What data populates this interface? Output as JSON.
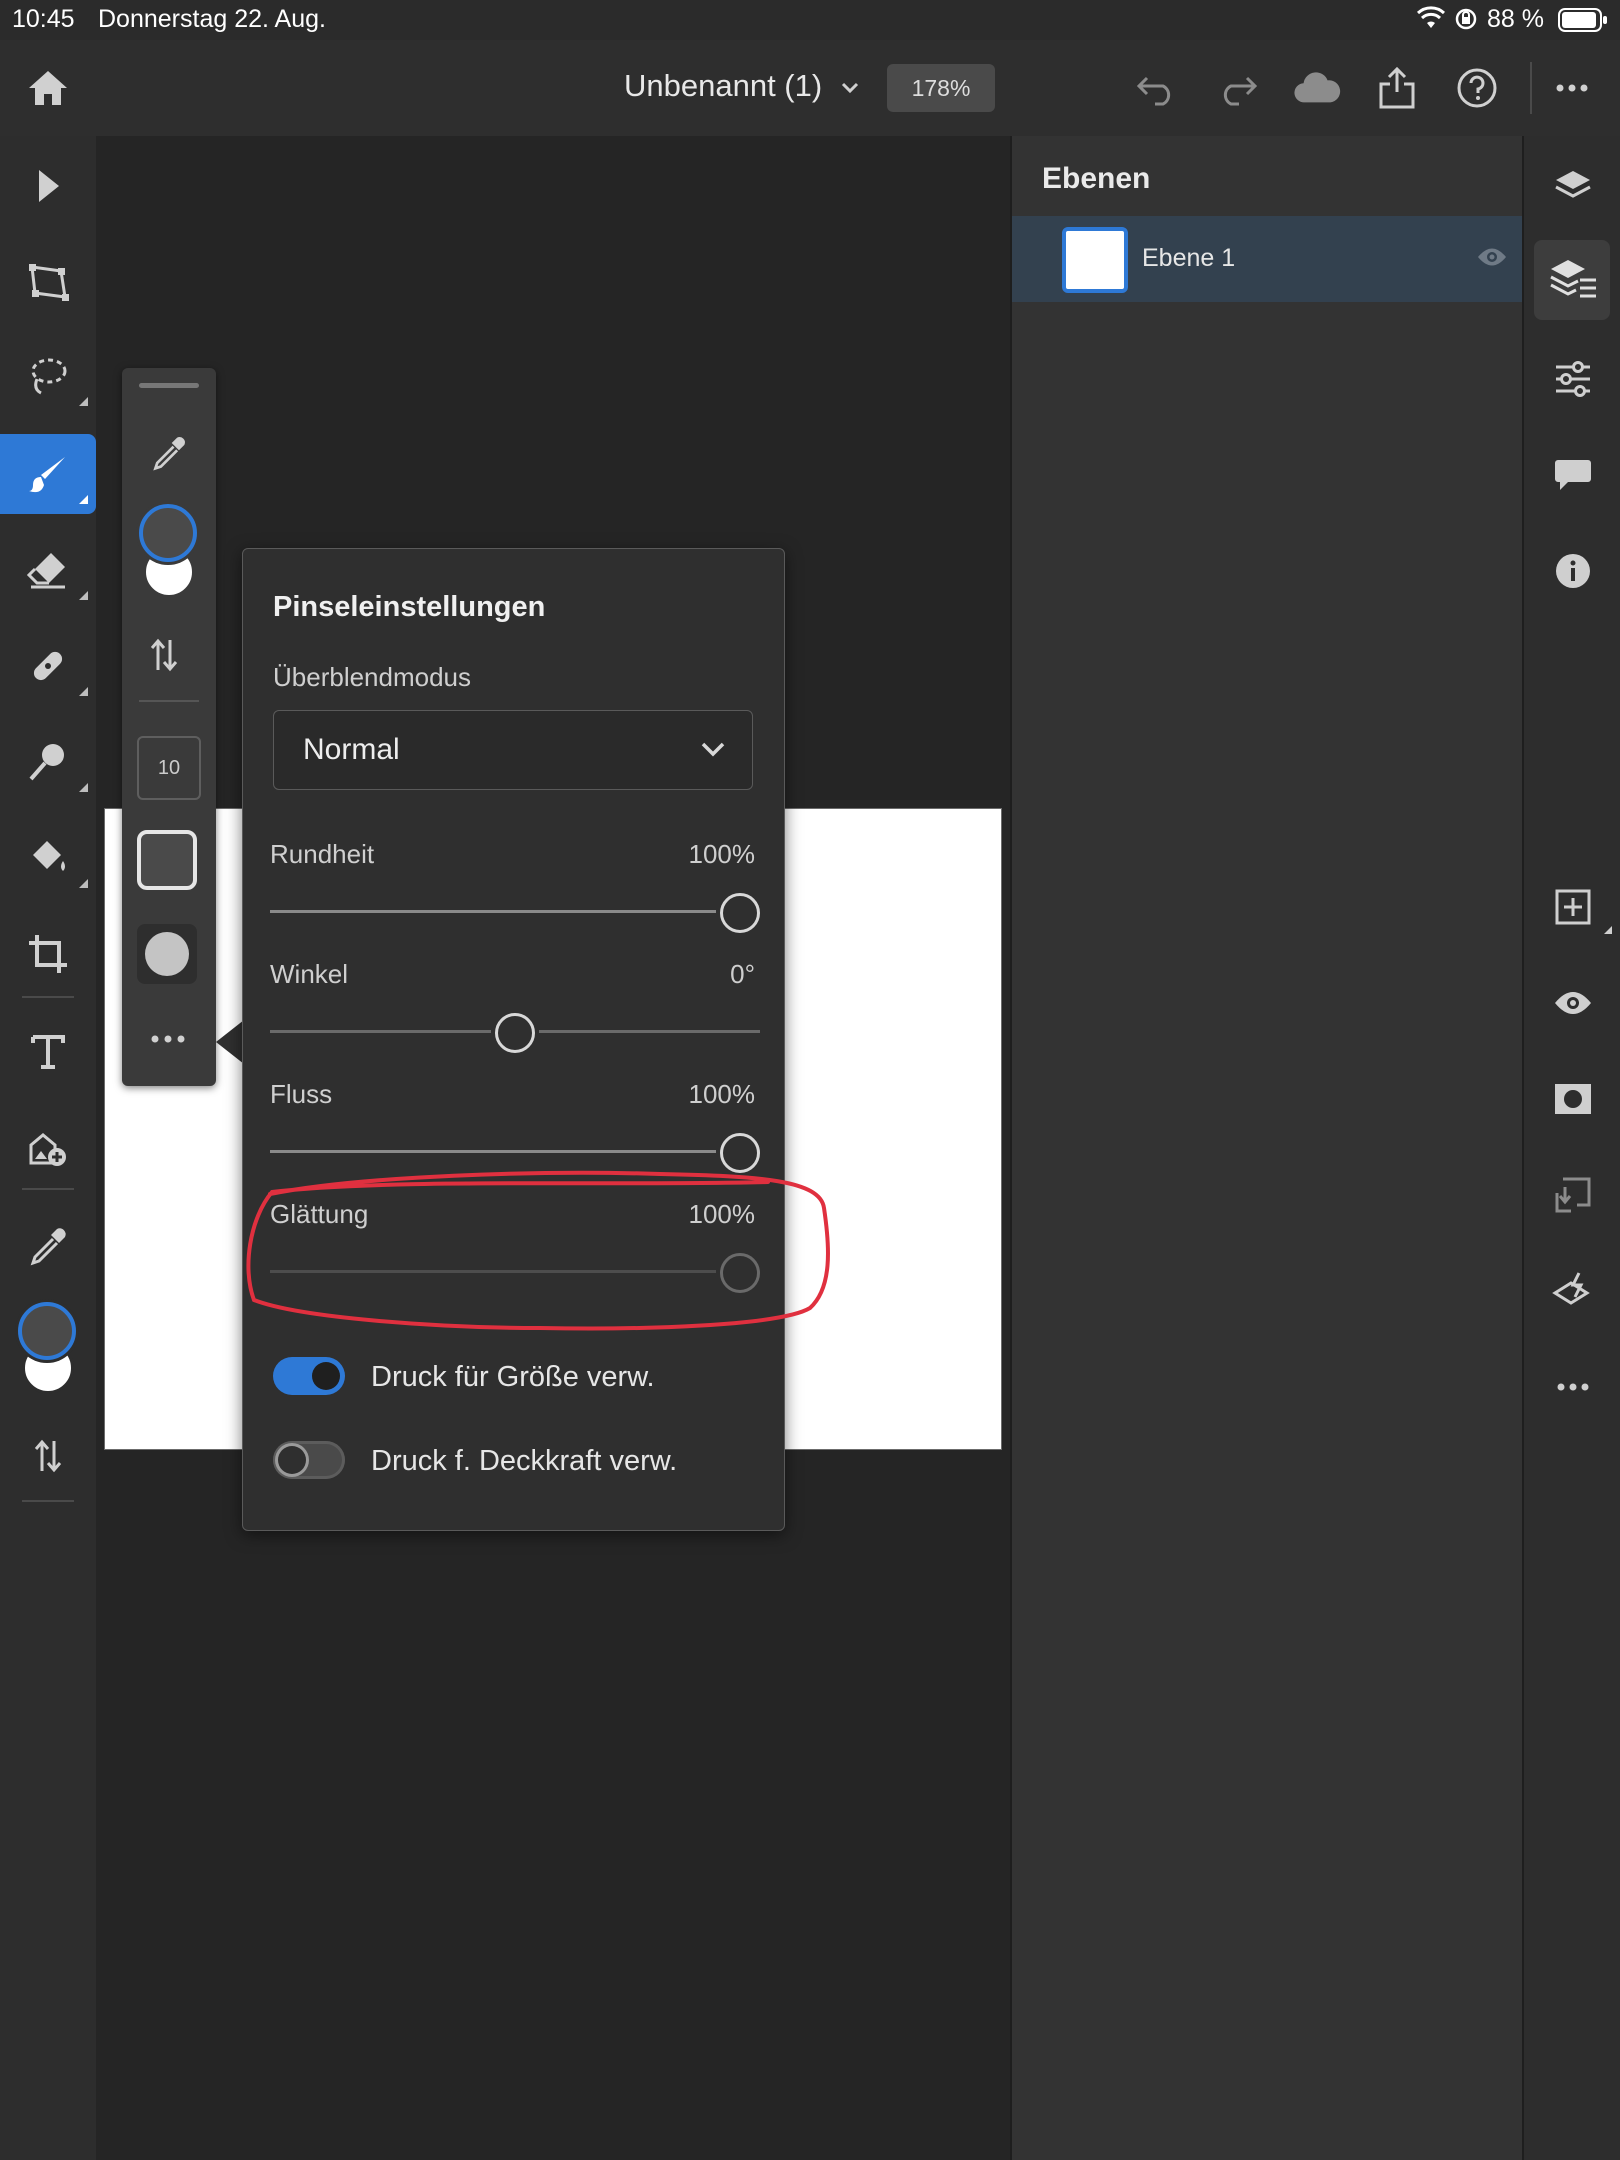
{
  "status_bar": {
    "time": "10:45",
    "date": "Donnerstag 22. Aug.",
    "battery": "88 %"
  },
  "top_bar": {
    "document_title": "Unbenannt (1)",
    "zoom": "178%"
  },
  "brush_toolbar": {
    "brush_size": "10"
  },
  "brush_settings": {
    "title": "Pinseleinstellungen",
    "blend_mode_label": "Überblendmodus",
    "blend_mode_value": "Normal",
    "sliders": [
      {
        "label": "Rundheit",
        "value": "100%",
        "level": 1.0,
        "enabled": true
      },
      {
        "label": "Winkel",
        "value": "0°",
        "level": 0.5,
        "enabled": true
      },
      {
        "label": "Fluss",
        "value": "100%",
        "level": 1.0,
        "enabled": true
      },
      {
        "label": "Glättung",
        "value": "100%",
        "level": 1.0,
        "enabled": false
      }
    ],
    "toggles": [
      {
        "label": "Druck für Größe verw.",
        "on": true
      },
      {
        "label": "Druck f. Deckkraft verw.",
        "on": false
      }
    ]
  },
  "layers_panel": {
    "title": "Ebenen",
    "layers": [
      {
        "name": "Ebene 1",
        "selected": true
      }
    ]
  },
  "colors": {
    "accent": "#2e79d6",
    "annotation": "#e0303f",
    "foreground_swatch": "#4a4a4a",
    "background_swatch": "#ffffff"
  }
}
